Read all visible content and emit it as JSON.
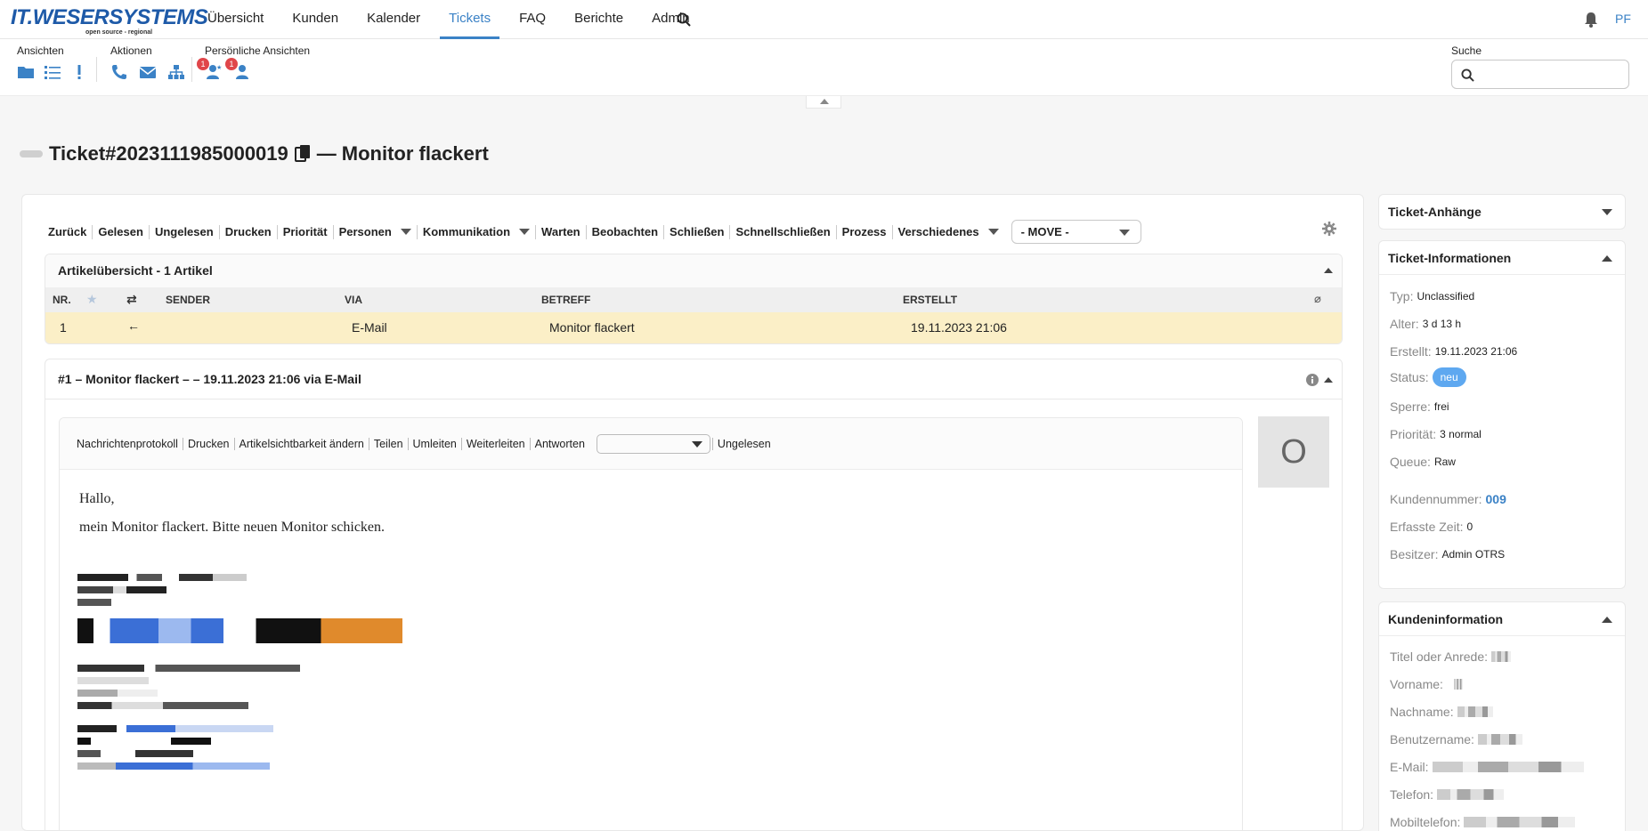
{
  "brand": {
    "line1": "IT.WESERSYSTEMS",
    "line2": "open source - regional"
  },
  "nav": {
    "items": [
      "Übersicht",
      "Kunden",
      "Kalender",
      "Tickets",
      "FAQ",
      "Berichte",
      "Admin"
    ],
    "active": "Tickets",
    "user_initials": "PF"
  },
  "toolbar": {
    "groups": {
      "ansichten": "Ansichten",
      "aktionen": "Aktionen",
      "persoenlich": "Persönliche Ansichten"
    },
    "badges": {
      "first": "1",
      "second": "1"
    },
    "search_label": "Suche",
    "search_placeholder": ""
  },
  "ticket": {
    "number": "Ticket#2023111985000019",
    "separator": "—",
    "title": "Monitor flackert"
  },
  "actions": {
    "items": [
      "Zurück",
      "Gelesen",
      "Ungelesen",
      "Drucken",
      "Priorität",
      "Personen",
      "Kommunikation",
      "Warten",
      "Beobachten",
      "Schließen",
      "Schnellschließen",
      "Prozess",
      "Verschiedenes"
    ],
    "move_label": "- MOVE -"
  },
  "article_overview": {
    "title": "Artikelübersicht - 1 Artikel",
    "columns": {
      "nr": "NR.",
      "sender": "SENDER",
      "via": "VIA",
      "subject": "BETREFF",
      "created": "ERSTELLT"
    },
    "rows": [
      {
        "nr": "1",
        "direction": "←",
        "via": "E-Mail",
        "subject": "Monitor flackert",
        "created": "19.11.2023 21:06"
      }
    ]
  },
  "article": {
    "header": "#1 – Monitor flackert – – 19.11.2023 21:06 via E-Mail",
    "actions": [
      "Nachrichtenprotokoll",
      "Drucken",
      "Artikelsichtbarkeit ändern",
      "Teilen",
      "Umleiten",
      "Weiterleiten",
      "Antworten"
    ],
    "after_select": "Ungelesen",
    "greeting": "Hallo,",
    "body": "mein Monitor flackert. Bitte neuen Monitor schicken.",
    "avatar_letter": "O"
  },
  "sidebar": {
    "attachments_title": "Ticket-Anhänge",
    "info_title": "Ticket-Informationen",
    "info": {
      "typ_label": "Typ:",
      "typ": "Unclassified",
      "alter_label": "Alter:",
      "alter": "3 d 13 h",
      "erstellt_label": "Erstellt:",
      "erstellt": "19.11.2023 21:06",
      "status_label": "Status:",
      "status": "neu",
      "sperre_label": "Sperre:",
      "sperre": "frei",
      "prio_label": "Priorität:",
      "prio": "3 normal",
      "queue_label": "Queue:",
      "queue": "Raw",
      "kundennr_label": "Kundennummer:",
      "kundennr": "009",
      "zeit_label": "Erfasste Zeit:",
      "zeit": "0",
      "besitzer_label": "Besitzer:",
      "besitzer": "Admin OTRS"
    },
    "customer_title": "Kundeninformation",
    "customer_labels": [
      "Titel oder Anrede:",
      "Vorname:",
      "Nachname:",
      "Benutzername:",
      "E-Mail:",
      "Telefon:",
      "Mobiltelefon:"
    ]
  },
  "colors": {
    "accent": "#3b82c6",
    "row_highlight": "#fbefc7",
    "badge": "#e0464a",
    "status": "#5ea8f0"
  }
}
